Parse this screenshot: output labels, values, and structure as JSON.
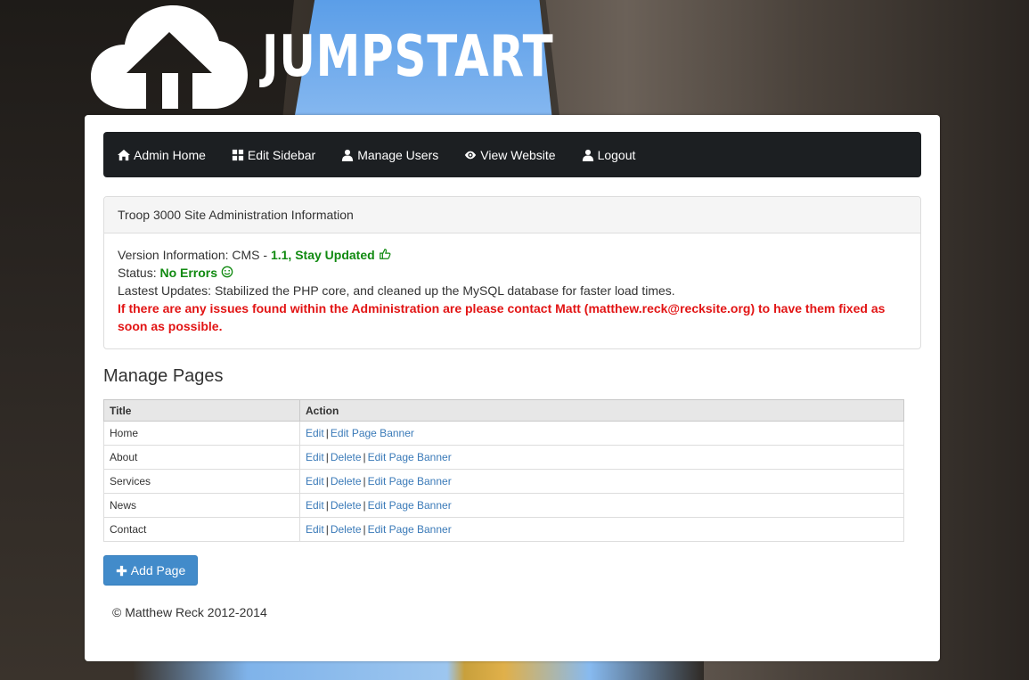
{
  "brand": {
    "logo_text": "JUMPSTART",
    "logo_icon": "cloud-upload-icon"
  },
  "nav": {
    "items": [
      {
        "label": "Admin Home",
        "icon": "home-icon"
      },
      {
        "label": "Edit Sidebar",
        "icon": "grid-icon"
      },
      {
        "label": "Manage Users",
        "icon": "user-icon"
      },
      {
        "label": "View Website",
        "icon": "eye-icon"
      },
      {
        "label": "Logout",
        "icon": "user-icon"
      }
    ]
  },
  "info_panel": {
    "heading": "Troop 3000 Site Administration Information",
    "version_label": "Version Information: CMS - ",
    "version_value": "1.1, Stay Updated",
    "status_label": "Status: ",
    "status_value": "No Errors",
    "latest_updates": "Lastest Updates: Stabilized the PHP core, and cleaned up the MySQL database for faster load times.",
    "notice": "If there are any issues found within the Administration are please contact Matt (matthew.reck@recksite.org) to have them fixed as soon as possible."
  },
  "manage_pages": {
    "title": "Manage Pages",
    "columns": [
      "Title",
      "Action"
    ],
    "rows": [
      {
        "title": "Home",
        "actions": [
          "Edit",
          "Edit Page Banner"
        ]
      },
      {
        "title": "About",
        "actions": [
          "Edit",
          "Delete",
          "Edit Page Banner"
        ]
      },
      {
        "title": "Services",
        "actions": [
          "Edit",
          "Delete",
          "Edit Page Banner"
        ]
      },
      {
        "title": "News",
        "actions": [
          "Edit",
          "Delete",
          "Edit Page Banner"
        ]
      },
      {
        "title": "Contact",
        "actions": [
          "Edit",
          "Delete",
          "Edit Page Banner"
        ]
      }
    ],
    "add_button": "Add Page"
  },
  "footer": {
    "copyright": "© Matthew Reck 2012-2014"
  },
  "colors": {
    "navbar": "#1c1f22",
    "success": "#118a11",
    "danger": "#e21414",
    "link": "#3a7ab8",
    "primary_button": "#428bca"
  }
}
